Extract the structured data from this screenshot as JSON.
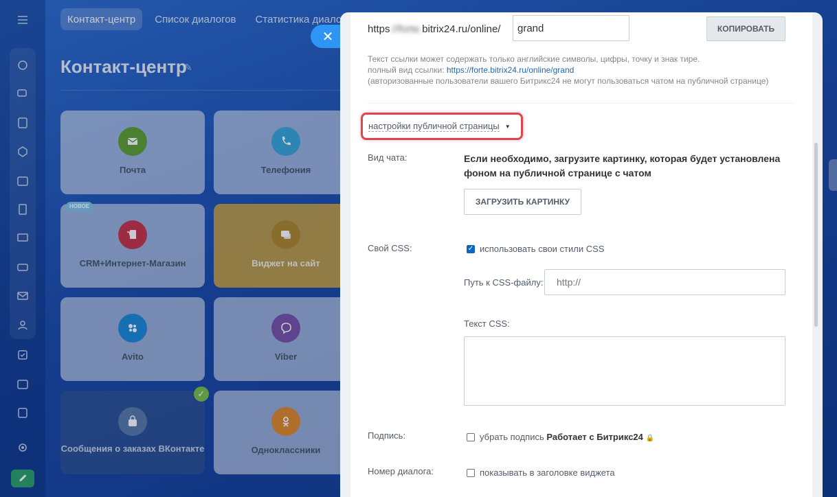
{
  "background": {
    "top_tabs": [
      "Контакт-центр",
      "Список диалогов",
      "Статистика диалогов"
    ],
    "page_title": "Контакт-центр",
    "tiles": [
      {
        "label": "Почта",
        "icon": "mail-icon",
        "color": "#5fa031"
      },
      {
        "label": "Телефония",
        "icon": "phone-icon",
        "color": "#3aa7d9"
      },
      {
        "label": "CRM+Интернет-Магазин",
        "icon": "shop-icon",
        "color": "#c8344a",
        "badge": "НОВОЕ"
      },
      {
        "label": "Виджет на сайт",
        "icon": "chat-widget-icon",
        "color": "#a07820"
      },
      {
        "label": "Avito",
        "icon": "avito-icon",
        "color": "#1d8bd6"
      },
      {
        "label": "Viber",
        "icon": "viber-icon",
        "color": "#7c52a8"
      },
      {
        "label": "Сообщения о заказах ВКонтакте",
        "icon": "vk-bag-icon",
        "color": "#5a7aa8"
      },
      {
        "label": "Одноклассники",
        "icon": "odnoklassniki-icon",
        "color": "#e0892a"
      }
    ]
  },
  "slider": {
    "url_prefix_start": "https",
    "url_prefix_blurred": "://forte.",
    "url_prefix_end": "bitrix24.ru/online/",
    "url_value": "grand",
    "copy_label": "КОПИРОВАТЬ",
    "hint_line1": "Текст ссылки может содержать только английские символы, цифры, точку и знак тире.",
    "hint_line2_label": "полный вид ссылки:",
    "hint_line2_link": "https://forte.bitrix24.ru/online/grand",
    "hint_line3": "(авторизованные пользователи вашего Битрикс24 не могут пользоваться чатом на публичной странице)",
    "section_toggle": "настройки публичной страницы",
    "chat_view_label": "Вид чата:",
    "chat_view_text": "Если необходимо, загрузите картинку, которая будет установлена фоном на публичной странице с чатом",
    "upload_label": "ЗАГРУЗИТЬ КАРТИНКУ",
    "own_css_label": "Свой CSS:",
    "own_css_checkbox": "использовать свои стили CSS",
    "own_css_checked": true,
    "css_path_label": "Путь к CSS-файлу:",
    "css_path_placeholder": "http://",
    "css_text_label": "Текст CSS:",
    "signature_label": "Подпись:",
    "signature_checkbox": "убрать подпись",
    "signature_bold": "Работает с Битрикс24",
    "dialog_number_label": "Номер диалога:",
    "dialog_number_checkbox": "показывать в заголовке виджета"
  }
}
